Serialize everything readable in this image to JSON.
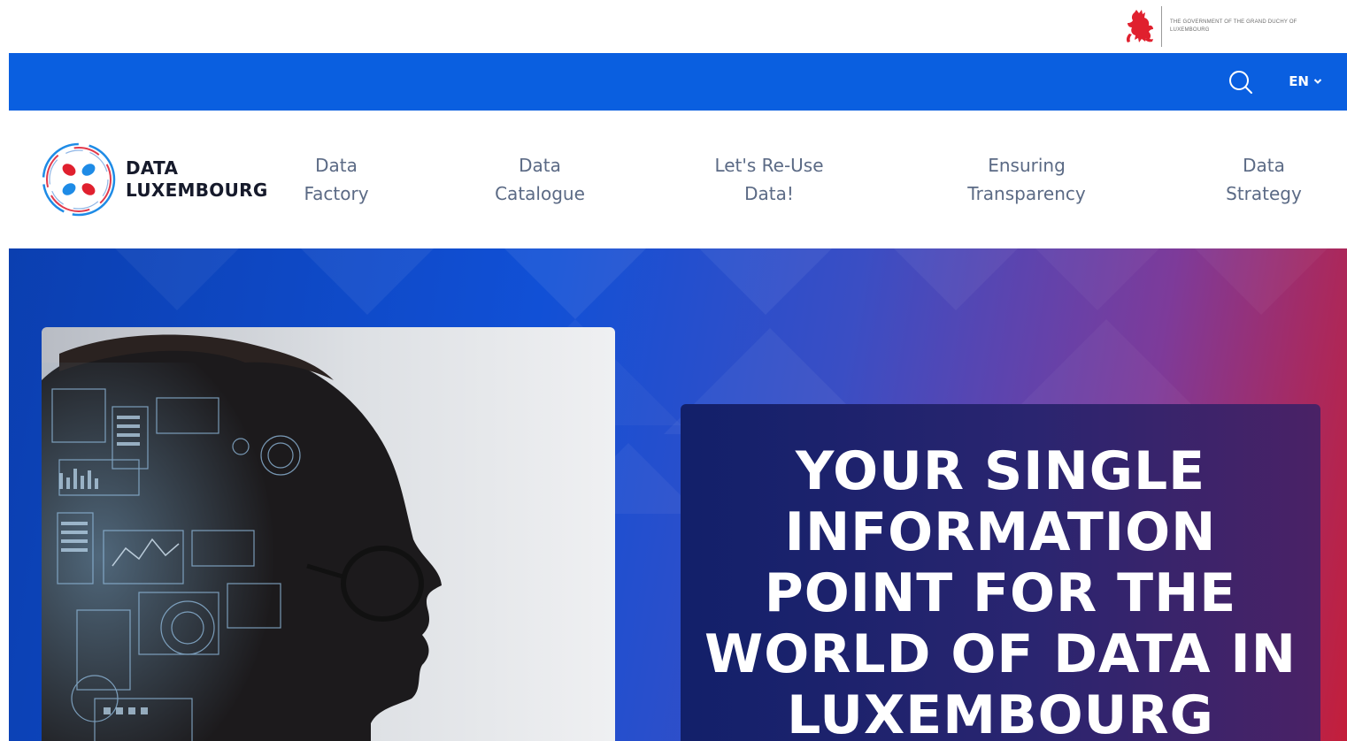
{
  "gov": {
    "text": "THE GOVERNMENT OF THE GRAND DUCHY OF LUXEMBOURG",
    "lion_color": "#e0202e"
  },
  "util": {
    "bar_color": "#0a5fe0",
    "language": "EN"
  },
  "brand": {
    "line1": "DATA",
    "line2": "LUXEMBOURG"
  },
  "nav": {
    "items": [
      {
        "line1": "Data",
        "line2": "Factory"
      },
      {
        "line1": "Data",
        "line2": "Catalogue"
      },
      {
        "line1": "Let's Re-Use",
        "line2": "Data!"
      },
      {
        "line1": "Ensuring",
        "line2": "Transparency"
      },
      {
        "line1": "Data",
        "line2": "Strategy"
      }
    ]
  },
  "hero": {
    "headline": {
      "line1": "YOUR SINGLE",
      "line2": "INFORMATION",
      "line3": "POINT FOR THE",
      "line4": "WORLD OF DATA IN",
      "line5": "LUXEMBOURG"
    }
  },
  "icons": {
    "search": "search-icon",
    "chevron": "chevron-down-icon",
    "lion": "red-lion-icon",
    "brand": "data-luxembourg-logo-icon"
  }
}
